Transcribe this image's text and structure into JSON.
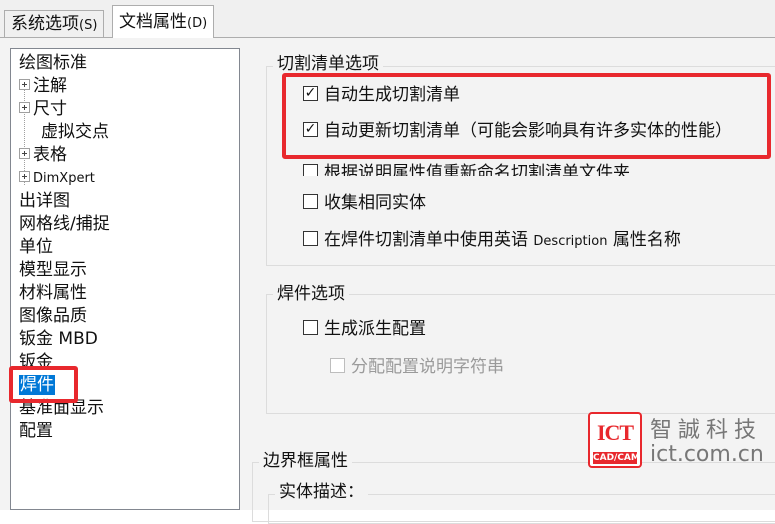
{
  "tabs": [
    {
      "label": "系统选项",
      "accel": "(S)"
    },
    {
      "label": "文档属性",
      "accel": "(D)"
    }
  ],
  "tree": {
    "items": [
      {
        "label": "绘图标准"
      },
      {
        "label": "注解"
      },
      {
        "label": "尺寸"
      },
      {
        "label": "虚拟交点"
      },
      {
        "label": "表格"
      },
      {
        "label": "DimXpert"
      },
      {
        "label": "出详图"
      },
      {
        "label": "网格线/捕捉"
      },
      {
        "label": "单位"
      },
      {
        "label": "模型显示"
      },
      {
        "label": "材料属性"
      },
      {
        "label": "图像品质"
      },
      {
        "label": "钣金 MBD"
      },
      {
        "label": "钣金"
      },
      {
        "label": "焊件"
      },
      {
        "label": "基准面显示"
      },
      {
        "label": "配置"
      }
    ],
    "selected": "焊件"
  },
  "groups": {
    "cutlist": {
      "title": "切割清单选项",
      "options": [
        {
          "label": "自动生成切割清单",
          "checked": true
        },
        {
          "label": "自动更新切割清单（可能会影响具有许多实体的性能）",
          "checked": true
        },
        {
          "label": "根据说明属性值重新命名切割清单文件夹",
          "checked": false
        },
        {
          "label": "收集相同实体",
          "checked": false
        },
        {
          "label_prefix": "在焊件切割清单中使用英语 ",
          "label_en": "Description",
          "label_suffix": " 属性名称",
          "checked": false
        }
      ]
    },
    "weldment": {
      "title": "焊件选项",
      "options": [
        {
          "label": "生成派生配置",
          "checked": false
        },
        {
          "label": "分配配置说明字符串",
          "checked": false,
          "disabled": true
        }
      ]
    },
    "bbox": {
      "title": "边界框属性",
      "sub_title": "实体描述："
    }
  },
  "colors": {
    "highlight_box": "#e8282d",
    "selection": "#0078d7"
  },
  "watermark": {
    "seal_text": "ICT",
    "seal_sub": "CAD/CAM",
    "company": "智誠科技",
    "domain": "ict.com.cn"
  }
}
